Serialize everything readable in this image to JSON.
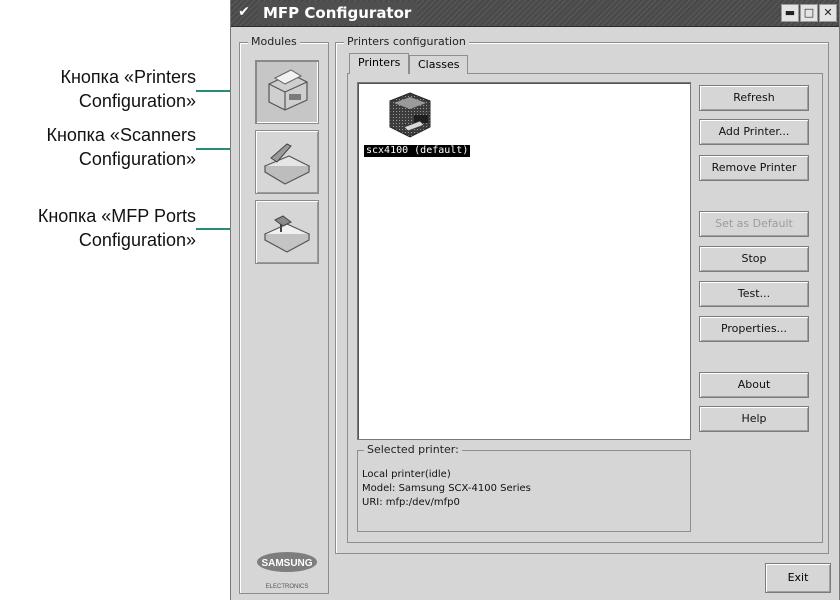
{
  "callouts": [
    {
      "line1": "Кнопка «Printers",
      "line2": "Configuration»"
    },
    {
      "line1": "Кнопка «Scanners",
      "line2": "Configuration»"
    },
    {
      "line1": "Кнопка «MFP Ports",
      "line2": "Configuration»"
    }
  ],
  "window": {
    "title": "MFP Configurator",
    "controls": {
      "minimize": "▬",
      "maximize": "□",
      "close": "✕"
    },
    "menu_glyph": "✔"
  },
  "modules": {
    "title": "Modules",
    "items": [
      {
        "name": "printers-config",
        "icon": "printer-icon",
        "active": true
      },
      {
        "name": "scanners-config",
        "icon": "scanner-icon",
        "active": false
      },
      {
        "name": "mfp-ports-config",
        "icon": "port-icon",
        "active": false
      }
    ],
    "brand": "SAMSUNG",
    "brand_sub": "ELECTRONICS"
  },
  "printers_config": {
    "title": "Printers configuration",
    "tabs": [
      "Printers",
      "Classes"
    ],
    "active_tab": "Printers",
    "printer_items": [
      {
        "label": "scx4100 (default)",
        "icon": "printer-icon"
      }
    ],
    "buttons": {
      "refresh": "Refresh",
      "add_printer": "Add Printer...",
      "remove_printer": "Remove Printer",
      "set_default": "Set as Default",
      "stop": "Stop",
      "test": "Test...",
      "properties": "Properties...",
      "about": "About",
      "help": "Help"
    },
    "selected": {
      "title": "Selected printer:",
      "status": "Local printer(idle)",
      "model": "Model: Samsung SCX-4100 Series",
      "uri": "URI: mfp:/dev/mfp0"
    }
  },
  "footer": {
    "exit": "Exit"
  },
  "colors": {
    "accent_line": "#2a8a78",
    "window_bg": "#d6d6d6",
    "titlebar": "#4f4f4f"
  }
}
